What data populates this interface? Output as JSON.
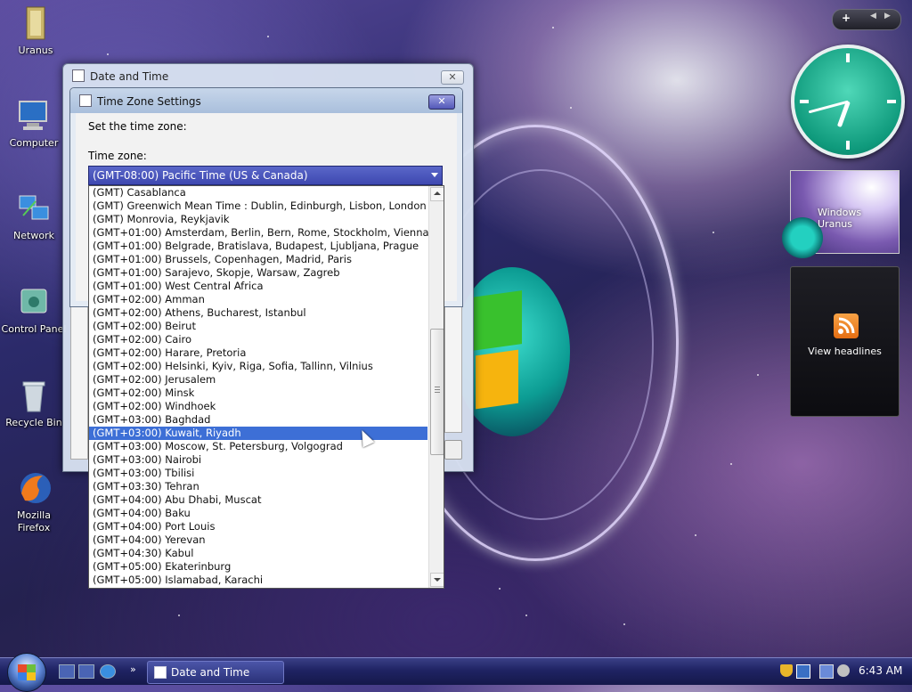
{
  "desktop": {
    "icons": [
      {
        "label": "Uranus"
      },
      {
        "label": "Computer"
      },
      {
        "label": "Network"
      },
      {
        "label": "Control Panel"
      },
      {
        "label": "Recycle Bin"
      },
      {
        "label": "Mozilla Firefox"
      }
    ]
  },
  "sidebar": {
    "add_button": "+",
    "photo_caption": "Windows Uranus",
    "feed_label": "View headlines"
  },
  "date_time_window": {
    "title": "Date and Time"
  },
  "time_zone_dialog": {
    "title": "Time Zone Settings",
    "prompt": "Set the time zone:",
    "time_zone_label": "Time zone:",
    "selected_value": "(GMT-08:00) Pacific Time (US & Canada)",
    "highlighted_option": "(GMT+03:00) Kuwait, Riyadh",
    "options": [
      "(GMT) Casablanca",
      "(GMT) Greenwich Mean Time : Dublin, Edinburgh, Lisbon, London",
      "(GMT) Monrovia, Reykjavik",
      "(GMT+01:00) Amsterdam, Berlin, Bern, Rome, Stockholm, Vienna",
      "(GMT+01:00) Belgrade, Bratislava, Budapest, Ljubljana, Prague",
      "(GMT+01:00) Brussels, Copenhagen, Madrid, Paris",
      "(GMT+01:00) Sarajevo, Skopje, Warsaw, Zagreb",
      "(GMT+01:00) West Central Africa",
      "(GMT+02:00) Amman",
      "(GMT+02:00) Athens, Bucharest, Istanbul",
      "(GMT+02:00) Beirut",
      "(GMT+02:00) Cairo",
      "(GMT+02:00) Harare, Pretoria",
      "(GMT+02:00) Helsinki, Kyiv, Riga, Sofia, Tallinn, Vilnius",
      "(GMT+02:00) Jerusalem",
      "(GMT+02:00) Minsk",
      "(GMT+02:00) Windhoek",
      "(GMT+03:00) Baghdad",
      "(GMT+03:00) Kuwait, Riyadh",
      "(GMT+03:00) Moscow, St. Petersburg, Volgograd",
      "(GMT+03:00) Nairobi",
      "(GMT+03:00) Tbilisi",
      "(GMT+03:30) Tehran",
      "(GMT+04:00) Abu Dhabi, Muscat",
      "(GMT+04:00) Baku",
      "(GMT+04:00) Port Louis",
      "(GMT+04:00) Yerevan",
      "(GMT+04:30) Kabul",
      "(GMT+05:00) Ekaterinburg",
      "(GMT+05:00) Islamabad, Karachi"
    ]
  },
  "taskbar": {
    "task_button": "Date and Time",
    "clock": "6:43 AM",
    "chevron": "»"
  },
  "colors": {
    "selection": "#3d6fd6",
    "taskbar": "#1f2363"
  }
}
